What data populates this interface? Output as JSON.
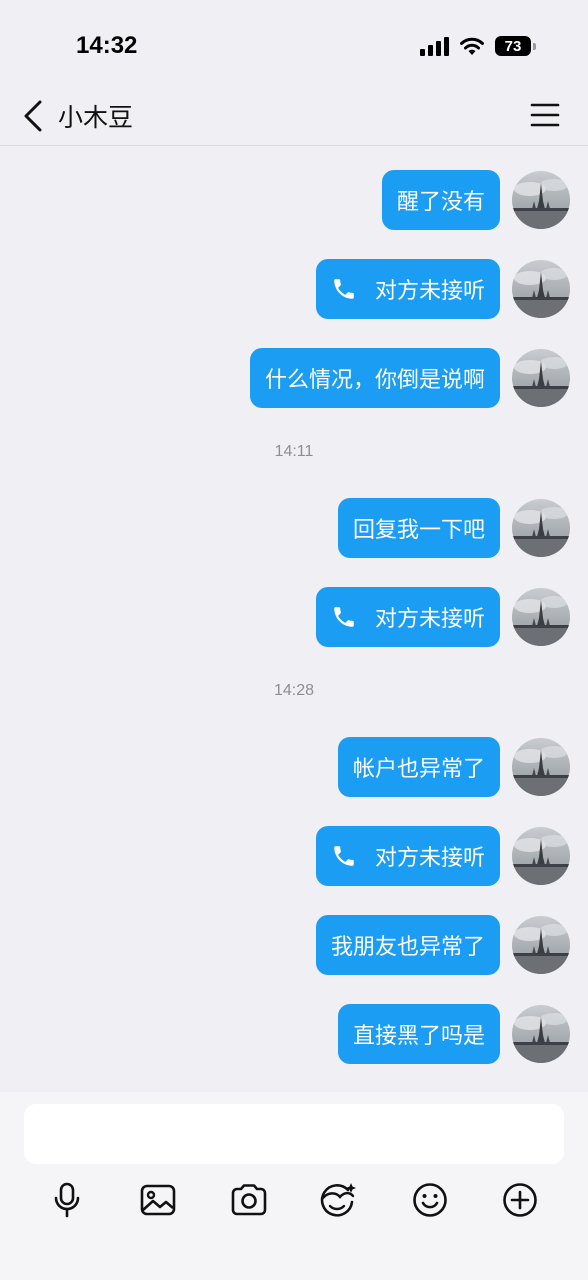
{
  "status_bar": {
    "time": "14:32",
    "battery": "73"
  },
  "header": {
    "title": "小木豆"
  },
  "messages": [
    {
      "type": "text",
      "text": "醒了没有"
    },
    {
      "type": "call",
      "text": "对方未接听"
    },
    {
      "type": "text",
      "text": "什么情况，你倒是说啊"
    },
    {
      "type": "time",
      "text": "14:11"
    },
    {
      "type": "text",
      "text": "回复我一下吧"
    },
    {
      "type": "call",
      "text": "对方未接听"
    },
    {
      "type": "time",
      "text": "14:28"
    },
    {
      "type": "text",
      "text": "帐户也异常了"
    },
    {
      "type": "call",
      "text": "对方未接听"
    },
    {
      "type": "text",
      "text": "我朋友也异常了"
    },
    {
      "type": "text",
      "text": "直接黑了吗是"
    }
  ],
  "input": {
    "value": ""
  },
  "toolbar": [
    "microphone-icon",
    "image-icon",
    "camera-icon",
    "sticker-icon",
    "emoji-icon",
    "plus-icon"
  ],
  "colors": {
    "bubble": "#1a9df2",
    "background": "#efeff4"
  }
}
